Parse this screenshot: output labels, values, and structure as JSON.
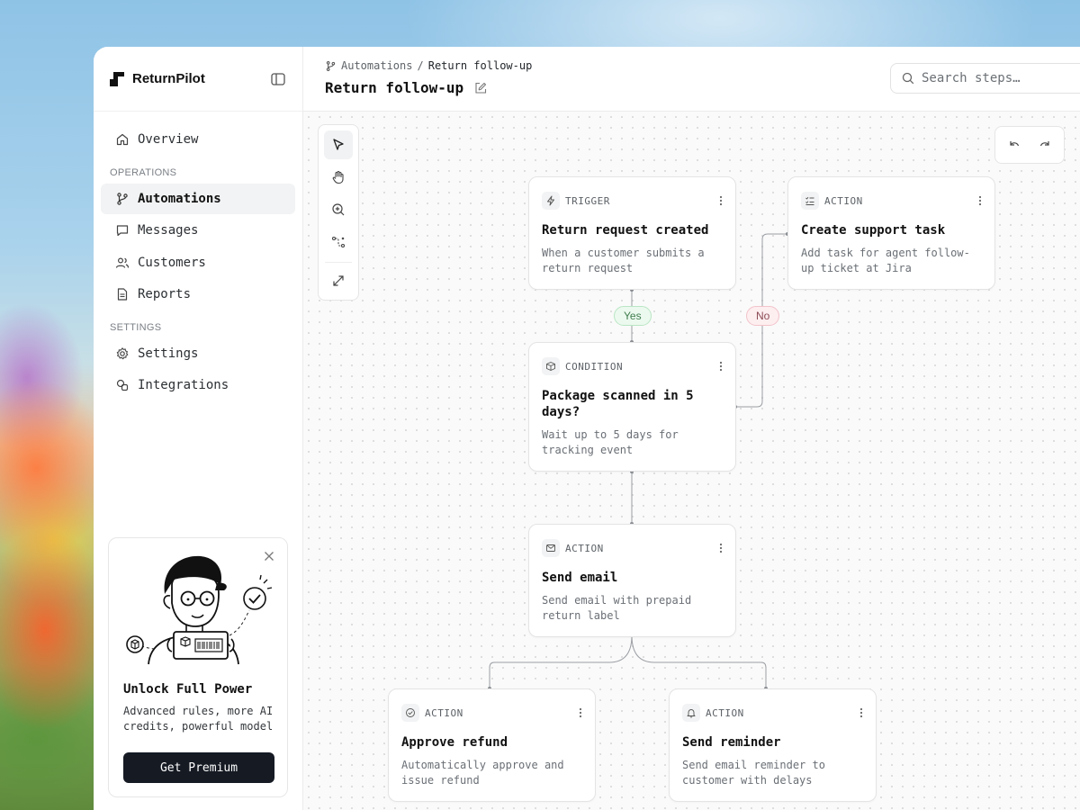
{
  "brand": {
    "name": "ReturnPilot"
  },
  "nav": {
    "overview": "Overview",
    "section_operations": "OPERATIONS",
    "automations": "Automations",
    "messages": "Messages",
    "customers": "Customers",
    "reports": "Reports",
    "section_settings": "SETTINGS",
    "settings": "Settings",
    "integrations": "Integrations"
  },
  "promo": {
    "title": "Unlock Full Power",
    "text": "Advanced rules, more AI credits, powerful model",
    "button": "Get Premium"
  },
  "header": {
    "breadcrumb_parent": "Automations",
    "breadcrumb_sep": "/",
    "breadcrumb_current": "Return follow-up",
    "title": "Return follow-up",
    "search_placeholder": "Search steps…"
  },
  "flow": {
    "trigger": {
      "type": "TRIGGER",
      "title": "Return request created",
      "desc": "When a customer submits a return request"
    },
    "support_task": {
      "type": "ACTION",
      "title": "Create support task",
      "desc": "Add task for agent follow-up ticket at Jira"
    },
    "condition": {
      "type": "CONDITION",
      "title": "Package scanned in 5 days?",
      "desc": "Wait up to 5 days for tracking event"
    },
    "send_email": {
      "type": "ACTION",
      "title": "Send email",
      "desc": "Send email with prepaid return label"
    },
    "approve_refund": {
      "type": "ACTION",
      "title": "Approve refund",
      "desc": "Automatically approve and issue refund"
    },
    "send_reminder": {
      "type": "ACTION",
      "title": "Send reminder",
      "desc": "Send email reminder to customer with delays"
    },
    "yes_label": "Yes",
    "no_label": "No"
  },
  "colors": {
    "accent_dark": "#151a23",
    "yes": "#3f7d4d",
    "no": "#8b4a53"
  }
}
